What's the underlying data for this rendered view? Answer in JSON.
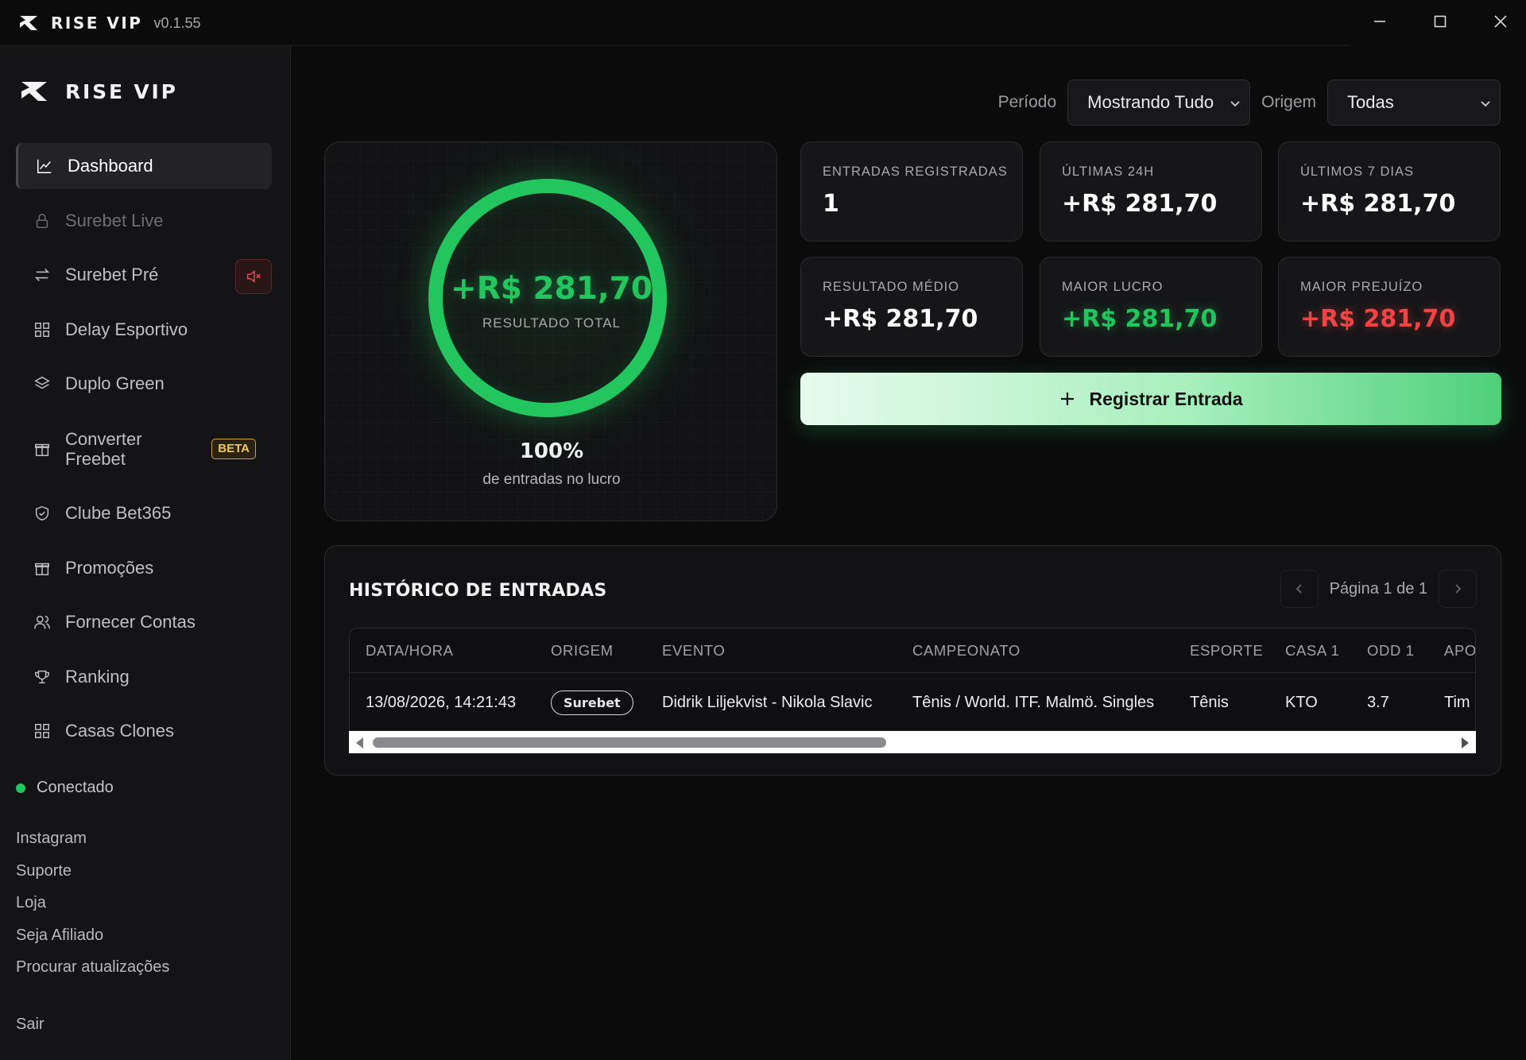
{
  "window": {
    "app_name": "RISE VIP",
    "version": "v0.1.55",
    "controls": [
      "minimize-icon",
      "maximize-icon",
      "close-icon"
    ]
  },
  "sidebar": {
    "brand": "RISE VIP",
    "items": [
      {
        "label": "Dashboard",
        "icon": "chart-line-icon",
        "active": true
      },
      {
        "label": "Surebet Live",
        "icon": "lock-icon",
        "locked": true
      },
      {
        "label": "Surebet Pré",
        "icon": "arrows-swap-icon"
      },
      {
        "label": "Delay Esportivo",
        "icon": "grid-icon"
      },
      {
        "label": "Duplo Green",
        "icon": "layers-icon"
      },
      {
        "label_line1": "Converter",
        "label_line2": "Freebet",
        "icon": "gift-icon",
        "badge": "BETA"
      },
      {
        "label": "Clube Bet365",
        "icon": "shield-check-icon"
      },
      {
        "label": "Promoções",
        "icon": "gift-icon"
      },
      {
        "label": "Fornecer Contas",
        "icon": "users-icon"
      },
      {
        "label": "Ranking",
        "icon": "trophy-icon"
      },
      {
        "label": "Casas Clones",
        "icon": "grid-icon"
      }
    ],
    "status": "Conectado",
    "links": [
      "Instagram",
      "Suporte",
      "Loja",
      "Seja Afiliado",
      "Procurar atualizações"
    ],
    "logout": "Sair"
  },
  "filters": {
    "period_label": "Período",
    "period_value": "Mostrando Tudo",
    "origin_label": "Origem",
    "origin_value": "Todas"
  },
  "summary": {
    "total_value": "+R$ 281,70",
    "total_label": "RESULTADO TOTAL",
    "profit_percent": "100%",
    "profit_caption": "de entradas no lucro",
    "ring_fill_fraction": 1.0
  },
  "stats": [
    {
      "label": "ENTRADAS REGISTRADAS",
      "value": "1",
      "tone": "white"
    },
    {
      "label": "ÚLTIMAS 24H",
      "value": "+R$ 281,70",
      "tone": "white"
    },
    {
      "label": "ÚLTIMOS 7 DIAS",
      "value": "+R$ 281,70",
      "tone": "white"
    },
    {
      "label": "RESULTADO MÉDIO",
      "value": "+R$ 281,70",
      "tone": "white"
    },
    {
      "label": "MAIOR LUCRO",
      "value": "+R$ 281,70",
      "tone": "green"
    },
    {
      "label": "MAIOR PREJUÍZO",
      "value": "+R$ 281,70",
      "tone": "red"
    }
  ],
  "register_button": "Registrar Entrada",
  "history": {
    "title": "HISTÓRICO DE ENTRADAS",
    "pagination": "Página 1 de 1",
    "columns": [
      "DATA/HORA",
      "ORIGEM",
      "EVENTO",
      "CAMPEONATO",
      "ESPORTE",
      "CASA 1",
      "ODD 1",
      "APO"
    ],
    "rows": [
      {
        "datetime": "13/08/2026, 14:21:43",
        "origin": "Surebet",
        "event": "Didrik Liljekvist - Nikola Slavic",
        "championship": "Tênis / World. ITF. Malmö. Singles",
        "sport": "Tênis",
        "house1": "KTO",
        "odd1": "3.7",
        "apo": "Tim"
      }
    ]
  },
  "colors": {
    "accent_green": "#22c55e",
    "loss_red": "#ef4444",
    "beta_gold": "#f2c94c",
    "background": "#0b0b0c"
  }
}
